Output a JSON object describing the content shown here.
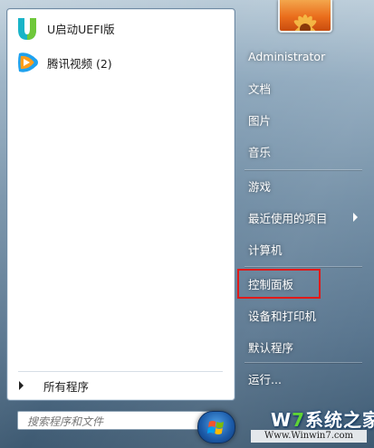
{
  "pinned_programs": [
    {
      "label": "U启动UEFI版",
      "icon": "u-qidong-icon"
    },
    {
      "label": "腾讯视频 (2)",
      "icon": "tencent-video-icon"
    }
  ],
  "all_programs": {
    "label": "所有程序"
  },
  "search": {
    "placeholder": "搜索程序和文件"
  },
  "right_menu": {
    "user": "Administrator",
    "documents": "文档",
    "pictures": "图片",
    "music": "音乐",
    "games": "游戏",
    "recent_items": "最近使用的项目",
    "computer": "计算机",
    "control_panel": "控制面板",
    "devices_printers": "设备和打印机",
    "default_programs": "默认程序",
    "run": "运行..."
  },
  "watermark": {
    "brand_prefix": "W",
    "brand_seven": "7",
    "brand_suffix": "系统之家",
    "url": "Www.Winwin7.com"
  },
  "colors": {
    "highlight": "#e11a1a",
    "watermark_seven": "#5fd335"
  }
}
